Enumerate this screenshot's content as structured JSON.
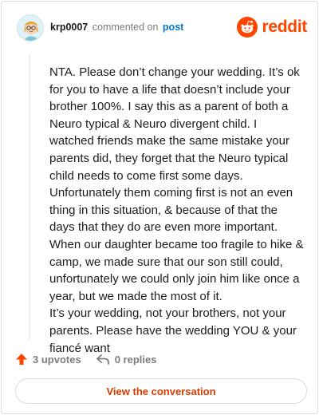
{
  "header": {
    "username": "krp0007",
    "verb": "commented on",
    "post_link": "post",
    "brand_word": "reddit"
  },
  "comment": {
    "paragraphs": [
      "NTA. Please don’t change your wedding. It’s ok for you to have a life that doesn’t include your brother 100%. I say this as a parent of both a Neuro typical & Neuro divergent child. I watched friends make the same mistake your parents did, they forget that the Neuro typical child needs to come first some days. Unfortunately them coming first is not an even thing in this situation, & because of that the days that they do are even more important. When our daughter became too fragile to hike & camp, we made sure that our son still could, unfortunately we could only join him like once a year, but we made the most of it.",
      "It’s your wedding, not your brothers, not your parents. Please have the wedding YOU & your fiancé want"
    ]
  },
  "actions": {
    "upvotes": "3 upvotes",
    "replies": "0 replies"
  },
  "cta": {
    "label": "View the conversation"
  },
  "colors": {
    "brand": "#ff4500",
    "link": "#0079d3",
    "cta_text": "#d93a00",
    "muted": "#7c7c7c"
  },
  "icons": [
    "avatar",
    "reddit-logo-icon",
    "upvote-arrow-icon",
    "reply-arrow-icon"
  ]
}
